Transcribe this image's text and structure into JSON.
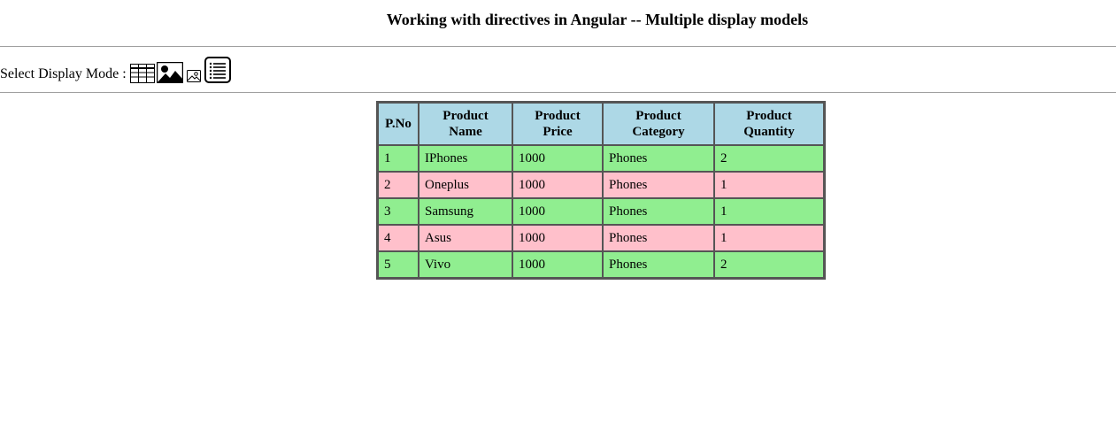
{
  "page": {
    "title": "Working with directives in Angular -- Multiple display models"
  },
  "mode_bar": {
    "label": "Select Display Mode : ",
    "icons": [
      "table-view-icon",
      "large-image-view-icon",
      "small-image-view-icon",
      "list-view-icon"
    ]
  },
  "table": {
    "headers": [
      [
        "P.No"
      ],
      [
        "Product",
        "Name"
      ],
      [
        "Product",
        "Price"
      ],
      [
        "Product",
        "Category"
      ],
      [
        "Product",
        "Quantity"
      ]
    ],
    "rows": [
      [
        "1",
        "IPhones",
        "1000",
        "Phones",
        "2"
      ],
      [
        "2",
        "Oneplus",
        "1000",
        "Phones",
        "1"
      ],
      [
        "3",
        "Samsung",
        "1000",
        "Phones",
        "1"
      ],
      [
        "4",
        "Asus",
        "1000",
        "Phones",
        "1"
      ],
      [
        "5",
        "Vivo",
        "1000",
        "Phones",
        "2"
      ]
    ]
  },
  "colors": {
    "header_bg": "#add8e6",
    "row_even_bg": "#90ee90",
    "row_odd_bg": "#ffc0cb"
  }
}
